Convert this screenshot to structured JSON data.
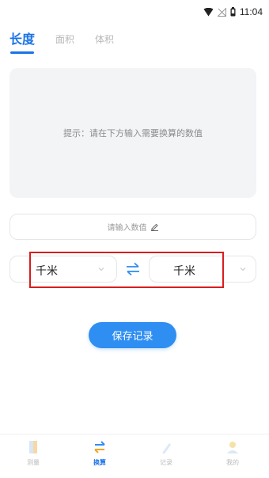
{
  "status_bar": {
    "time": "11:04"
  },
  "tabs": [
    {
      "label": "长度",
      "active": true
    },
    {
      "label": "面积",
      "active": false
    },
    {
      "label": "体积",
      "active": false
    }
  ],
  "prompt": {
    "text": "提示：请在下方输入需要换算的数值"
  },
  "input": {
    "placeholder": "请输入数值"
  },
  "units": {
    "from": "千米",
    "to": "千米"
  },
  "save_button": {
    "label": "保存记录"
  },
  "bottom_nav": [
    {
      "label": "测量",
      "active": false
    },
    {
      "label": "换算",
      "active": true
    },
    {
      "label": "记录",
      "active": false
    },
    {
      "label": "我的",
      "active": false
    }
  ],
  "colors": {
    "accent": "#1a73e8",
    "button": "#2f8ef2",
    "highlight": "#d81e1e"
  }
}
